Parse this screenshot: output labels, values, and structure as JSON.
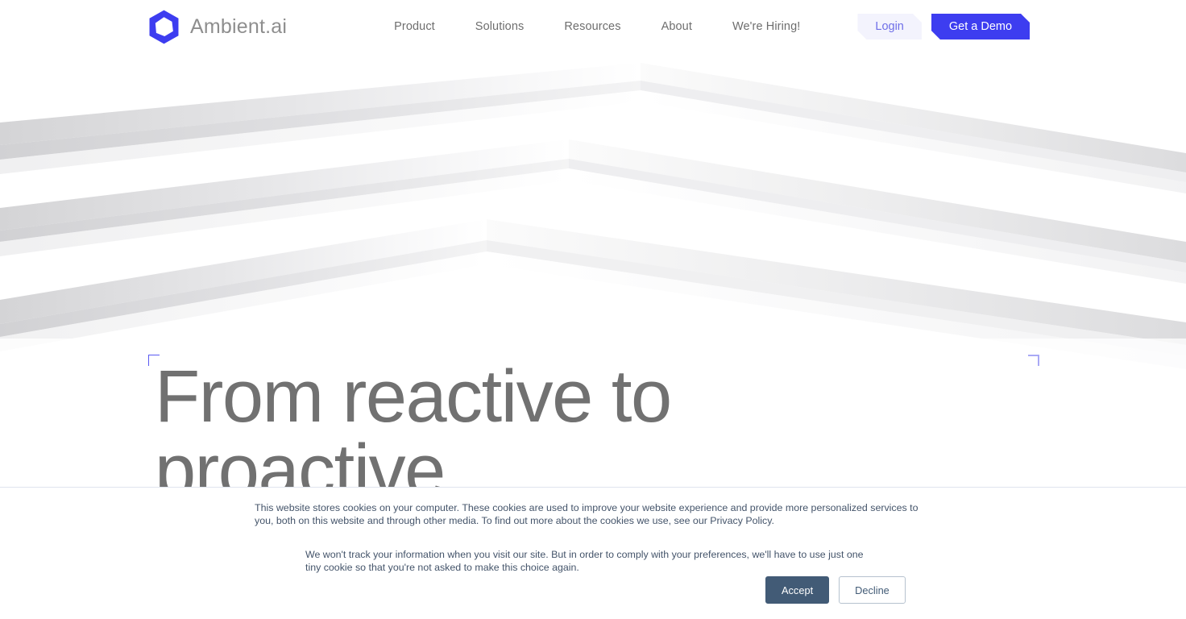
{
  "brand": {
    "name": "Ambient.ai",
    "logo_icon": "hexagon-logo-icon",
    "logo_color": "#3d3df0"
  },
  "nav": {
    "items": [
      {
        "label": "Product"
      },
      {
        "label": "Solutions"
      },
      {
        "label": "Resources"
      },
      {
        "label": "About"
      },
      {
        "label": "We're Hiring!"
      }
    ],
    "login_label": "Login",
    "demo_label": "Get a Demo",
    "login_color": "#6f6fe8",
    "demo_color": "#3d3df0"
  },
  "hero": {
    "title": "From reactive to proactive",
    "title_color": "#717171",
    "bracket_color_left": "#5a5af2",
    "bracket_color_right": "#a9a9f5"
  },
  "cookie_banner": {
    "paragraph_1_before_link": "This website stores cookies on your computer. These cookies are used to improve your website experience and provide more personalized services to you, both on this website and through other media. To find out more about the cookies we use, see our ",
    "privacy_policy_label": "Privacy Policy",
    "paragraph_1_after_link": ".",
    "paragraph_2": "We won't track your information when you visit our site. But in order to comply with your preferences, we'll have to use just one tiny cookie so that you're not asked to make this choice again.",
    "accept_label": "Accept",
    "decline_label": "Decline",
    "accept_color": "#425b76",
    "text_color": "#44546a"
  }
}
